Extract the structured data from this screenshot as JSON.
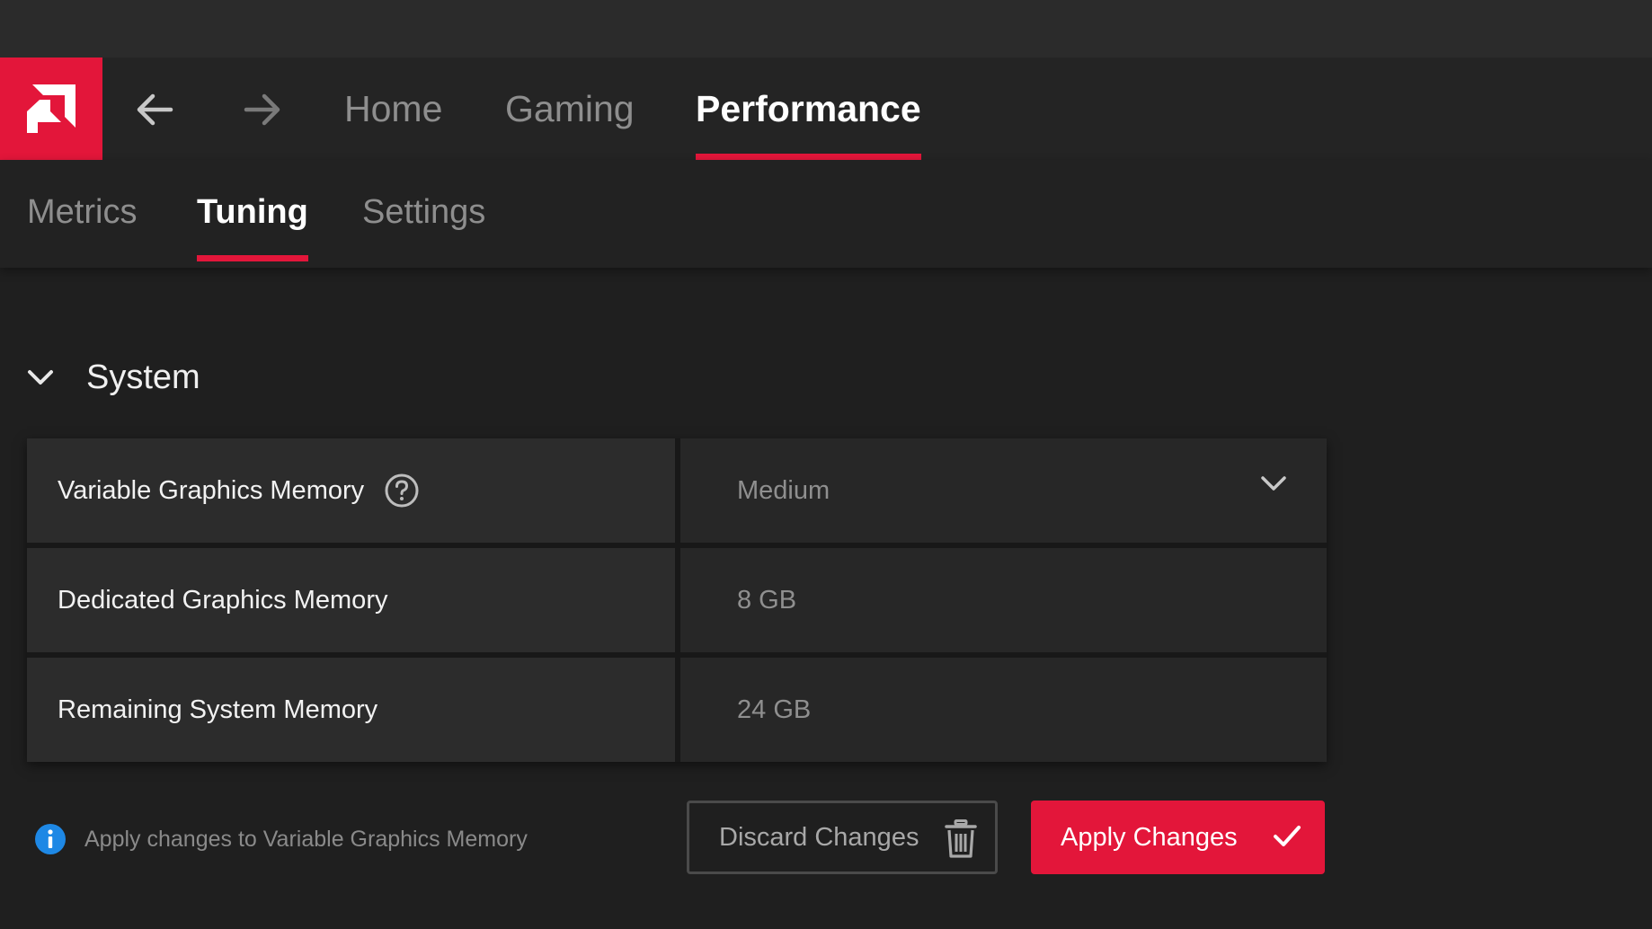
{
  "app": {
    "brand": "AMD",
    "accent_color": "#e3163a"
  },
  "nav": {
    "back_icon": "arrow-left-icon",
    "forward_icon": "arrow-right-icon",
    "tabs": [
      {
        "label": "Home",
        "active": false
      },
      {
        "label": "Gaming",
        "active": false
      },
      {
        "label": "Performance",
        "active": true
      }
    ]
  },
  "subnav": {
    "tabs": [
      {
        "label": "Metrics",
        "active": false
      },
      {
        "label": "Tuning",
        "active": true
      },
      {
        "label": "Settings",
        "active": false
      }
    ]
  },
  "section": {
    "title": "System",
    "expanded": true,
    "rows": [
      {
        "label": "Variable Graphics Memory",
        "value": "Medium",
        "control": "dropdown",
        "help_icon": "question-circle-icon"
      },
      {
        "label": "Dedicated Graphics Memory",
        "value": "8 GB"
      },
      {
        "label": "Remaining System Memory",
        "value": "24 GB"
      }
    ]
  },
  "footer": {
    "info_icon": "info-circle-icon",
    "info_color": "#1e88e5",
    "info_text": "Apply changes to Variable Graphics Memory",
    "discard_label": "Discard Changes",
    "discard_icon": "trash-icon",
    "apply_label": "Apply Changes",
    "apply_icon": "checkmark-icon"
  }
}
